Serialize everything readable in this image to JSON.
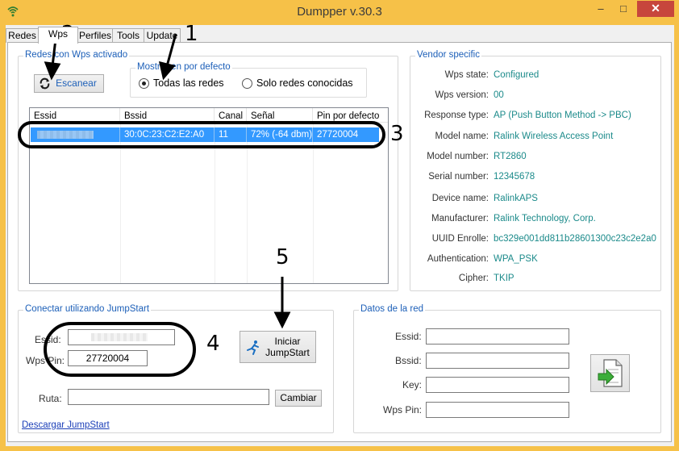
{
  "window": {
    "title": "Dumpper v.30.3",
    "minimize": "–",
    "maximize": "□",
    "close": "✕"
  },
  "tabs": [
    {
      "label": "Redes"
    },
    {
      "label": "Wps"
    },
    {
      "label": "Perfiles"
    },
    {
      "label": "Tools"
    },
    {
      "label": "Update"
    }
  ],
  "wps_group": {
    "title": "Redes con Wps activado",
    "scan_button": "Escanear",
    "display_group_title": "Mostrar en por defecto",
    "radio_all": "Todas las redes",
    "radio_known": "Solo redes conocidas",
    "columns": [
      "Essid",
      "Bssid",
      "Canal",
      "Señal",
      "Pin por defecto"
    ],
    "rows": [
      {
        "essid": "",
        "bssid": "30:0C:23:C2:E2:A0",
        "canal": "11",
        "senal": "72% (-64 dbm)",
        "pin": "27720004"
      }
    ]
  },
  "vendor": {
    "title": "Vendor specific",
    "items": [
      {
        "label": "Wps state:",
        "value": "Configured"
      },
      {
        "label": "Wps version:",
        "value": "00"
      },
      {
        "label": "Response type:",
        "value": "AP (Push Button Method -> PBC)"
      },
      {
        "label": "Model name:",
        "value": "Ralink Wireless Access Point"
      },
      {
        "label": "Model number:",
        "value": "RT2860"
      },
      {
        "label": "Serial number:",
        "value": "12345678"
      },
      {
        "label": "Device name:",
        "value": "RalinkAPS"
      },
      {
        "label": "Manufacturer:",
        "value": "Ralink Technology, Corp."
      },
      {
        "label": "UUID Enrolle:",
        "value": "bc329e001dd811b28601300c23c2e2a0"
      },
      {
        "label": "Authentication:",
        "value": "WPA_PSK"
      },
      {
        "label": "Cipher:",
        "value": "TKIP"
      }
    ]
  },
  "jumpstart": {
    "title": "Conectar utilizando JumpStart",
    "essid_label": "Essid:",
    "essid_value": "",
    "wpspin_label": "Wps Pin:",
    "wpspin_value": "27720004",
    "start_button_line1": "Iniciar",
    "start_button_line2": "JumpStart",
    "ruta_label": "Ruta:",
    "ruta_value": "",
    "cambiar_button": "Cambiar",
    "download_link": "Descargar JumpStart"
  },
  "network_data": {
    "title": "Datos de la red",
    "essid_label": "Essid:",
    "bssid_label": "Bssid:",
    "key_label": "Key:",
    "wpspin_label": "Wps Pin:",
    "essid_value": "",
    "bssid_value": "",
    "key_value": "",
    "wpspin_value": ""
  },
  "annotations": {
    "n1": "1",
    "n2": "2",
    "n3": "3",
    "n4": "4",
    "n5": "5"
  },
  "colors": {
    "title_bar": "#f6c148",
    "close_button": "#c7463c",
    "group_title": "#1c5fb8",
    "vendor_value": "#1b8a8a",
    "selection": "#3399ff"
  }
}
